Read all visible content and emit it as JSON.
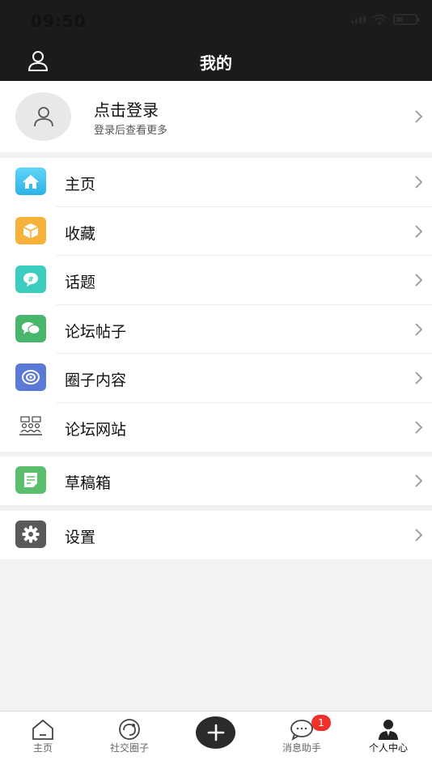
{
  "status_bar": {
    "time": "09:50"
  },
  "nav": {
    "title": "我的"
  },
  "profile": {
    "title": "点击登录",
    "subtitle": "登录后查看更多"
  },
  "menu_group_1": [
    {
      "label": "主页",
      "icon": "home-icon",
      "color": "#3cc6f0"
    },
    {
      "label": "收藏",
      "icon": "box-icon",
      "color": "#f7b23b"
    },
    {
      "label": "话题",
      "icon": "hashtag-chat-icon",
      "color": "#3ccdbf"
    },
    {
      "label": "论坛帖子",
      "icon": "chat-bubbles-icon",
      "color": "#48b66b"
    },
    {
      "label": "圈子内容",
      "icon": "circle-eye-icon",
      "color": "#5b7ad8"
    },
    {
      "label": "论坛网站",
      "icon": "forum-people-icon",
      "color": "#ffffff"
    }
  ],
  "menu_group_2": [
    {
      "label": "草稿箱",
      "icon": "draft-note-icon",
      "color": "#5cbf6e"
    }
  ],
  "menu_group_3": [
    {
      "label": "设置",
      "icon": "gear-icon",
      "color": "#5a5a5a"
    }
  ],
  "tabs": [
    {
      "label": "主页",
      "icon": "home-outline-icon"
    },
    {
      "label": "社交圈子",
      "icon": "social-circle-icon"
    },
    {
      "label": "",
      "icon": "plus-icon"
    },
    {
      "label": "消息助手",
      "icon": "message-bubble-icon",
      "badge": "1"
    },
    {
      "label": "个人中心",
      "icon": "person-filled-icon",
      "active": true
    }
  ]
}
